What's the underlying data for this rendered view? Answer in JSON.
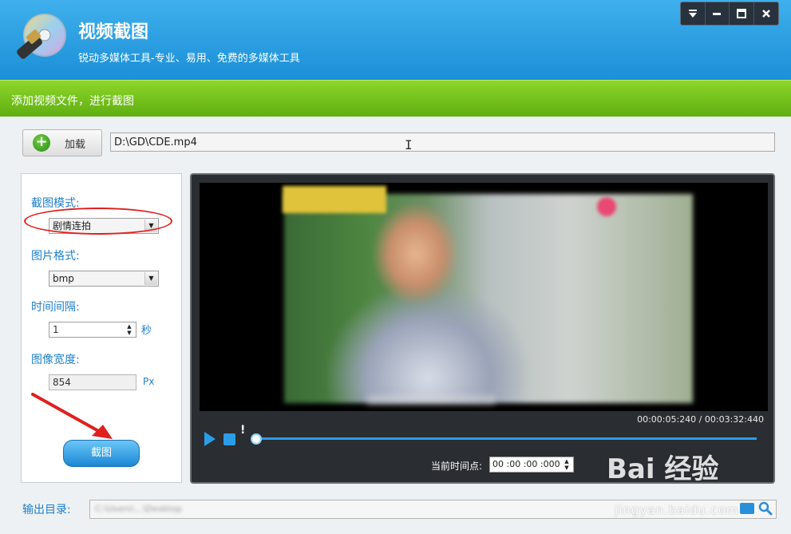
{
  "app": {
    "title": "视频截图",
    "subtitle": "锐动多媒体工具-专业、易用、免费的多媒体工具",
    "window_controls": [
      "menu-icon",
      "minimize-icon",
      "maximize-icon",
      "close-icon"
    ]
  },
  "step_bar": {
    "label": "添加视频文件，进行截图"
  },
  "load": {
    "button_label": "加载",
    "file_path": "D:\\GD\\CDE.mp4"
  },
  "settings": {
    "mode_label": "截图模式:",
    "mode_value": "剧情连拍",
    "format_label": "图片格式:",
    "format_value": "bmp",
    "interval_label": "时间间隔:",
    "interval_value": "1",
    "interval_unit": "秒",
    "width_label": "图像宽度:",
    "width_value": "854",
    "width_unit": "Px",
    "capture_button": "截图"
  },
  "player": {
    "time_display": "00:00:05:240 / 00:03:32:440",
    "current_time_label": "当前时间点:",
    "current_time_value": "00 :00 :00 :000",
    "progress": 0.0
  },
  "output": {
    "label": "输出目录:",
    "path_text": "C:\\Users\\...\\Desktop"
  },
  "watermark": {
    "brand": "Bai 经验",
    "url": "jingyan.baidu.com"
  },
  "colors": {
    "header": "#1b8fd8",
    "green_bar": "#5fae12",
    "accent": "#2b9de8",
    "label_blue": "#1f7fc9",
    "highlight_red": "#e0201e"
  }
}
